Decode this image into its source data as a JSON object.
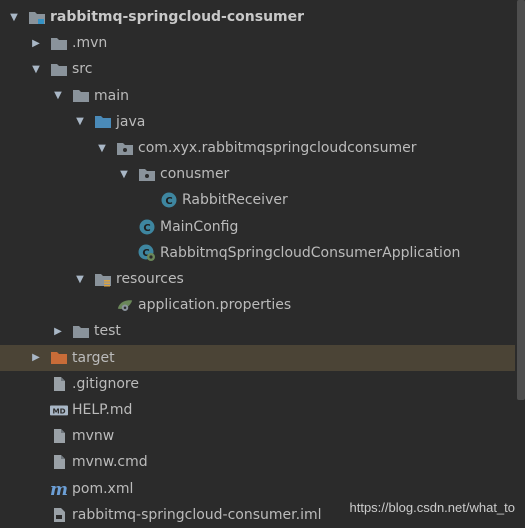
{
  "colors": {
    "background": "#2b2b2b",
    "selected_row": "#4b4436",
    "folder": "#8a939b",
    "source_folder": "#4a8ab8",
    "excluded_folder": "#c86c38",
    "class_icon": "#3e86a0"
  },
  "tree": [
    {
      "label": "rabbitmq-springcloud-consumer",
      "depth": 0,
      "arrow": "expanded",
      "icon": "module-folder-icon",
      "bold": true
    },
    {
      "label": ".mvn",
      "depth": 1,
      "arrow": "collapsed",
      "icon": "folder-icon"
    },
    {
      "label": "src",
      "depth": 1,
      "arrow": "expanded",
      "icon": "folder-icon"
    },
    {
      "label": "main",
      "depth": 2,
      "arrow": "expanded",
      "icon": "folder-icon"
    },
    {
      "label": "java",
      "depth": 3,
      "arrow": "expanded",
      "icon": "source-folder-icon"
    },
    {
      "label": "com.xyx.rabbitmqspringcloudconsumer",
      "depth": 4,
      "arrow": "expanded",
      "icon": "package-icon"
    },
    {
      "label": "conusmer",
      "depth": 5,
      "arrow": "expanded",
      "icon": "package-icon"
    },
    {
      "label": "RabbitReceiver",
      "depth": 6,
      "arrow": "none",
      "icon": "class-icon"
    },
    {
      "label": "MainConfig",
      "depth": 5,
      "arrow": "none",
      "icon": "class-icon"
    },
    {
      "label": "RabbitmqSpringcloudConsumerApplication",
      "depth": 5,
      "arrow": "none",
      "icon": "spring-boot-class-icon"
    },
    {
      "label": "resources",
      "depth": 3,
      "arrow": "expanded",
      "icon": "resources-folder-icon"
    },
    {
      "label": "application.properties",
      "depth": 4,
      "arrow": "none",
      "icon": "spring-properties-icon"
    },
    {
      "label": "test",
      "depth": 2,
      "arrow": "collapsed",
      "icon": "folder-icon"
    },
    {
      "label": "target",
      "depth": 1,
      "arrow": "collapsed",
      "icon": "excluded-folder-icon",
      "selected": true
    },
    {
      "label": ".gitignore",
      "depth": 1,
      "arrow": "none",
      "icon": "text-file-icon"
    },
    {
      "label": "HELP.md",
      "depth": 1,
      "arrow": "none",
      "icon": "markdown-file-icon"
    },
    {
      "label": "mvnw",
      "depth": 1,
      "arrow": "none",
      "icon": "text-file-icon"
    },
    {
      "label": "mvnw.cmd",
      "depth": 1,
      "arrow": "none",
      "icon": "text-file-icon"
    },
    {
      "label": "pom.xml",
      "depth": 1,
      "arrow": "none",
      "icon": "maven-file-icon"
    },
    {
      "label": "rabbitmq-springcloud-consumer.iml",
      "depth": 1,
      "arrow": "none",
      "icon": "iml-file-icon"
    }
  ],
  "watermark": "https://blog.csdn.net/what_to"
}
